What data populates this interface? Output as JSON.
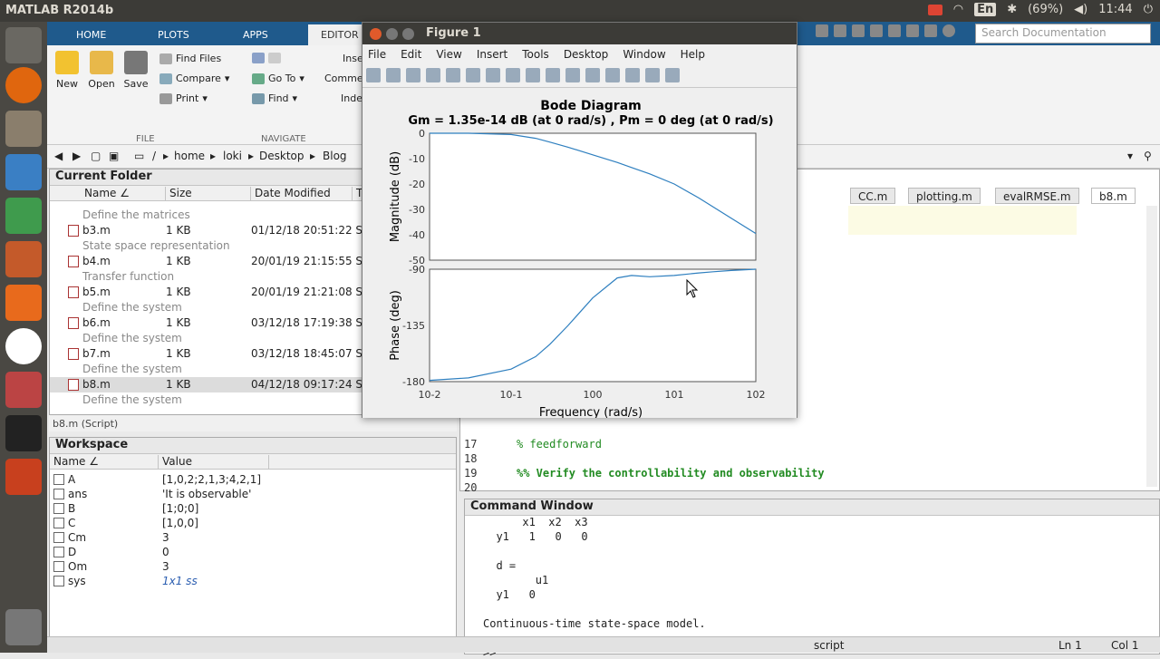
{
  "topbar": {
    "title": "MATLAB R2014b",
    "lang": "En",
    "battery": "(69%)",
    "time": "11:44"
  },
  "ribbon": {
    "tabs": [
      "HOME",
      "PLOTS",
      "APPS",
      "EDITOR"
    ],
    "new": "New",
    "open": "Open",
    "save": "Save",
    "find_files": "Find Files",
    "compare": "Compare",
    "print": "Print",
    "goto": "Go To",
    "comment": "Comme",
    "find": "Find",
    "insert": "Inse",
    "indent": "Inde",
    "file_group": "FILE",
    "navigate_group": "NAVIGATE"
  },
  "search_placeholder": "Search Documentation",
  "address": {
    "root": "/",
    "parts": [
      "home",
      "loki",
      "Desktop",
      "Blog"
    ]
  },
  "folder": {
    "title": "Current Folder",
    "headers": [
      "Name ∠",
      "Size",
      "Date Modified",
      "T"
    ],
    "rows": [
      {
        "desc": "Define the matrices"
      },
      {
        "name": "b3.m",
        "size": "1 KB",
        "date": "01/12/18 20:51:22",
        "t": "S"
      },
      {
        "desc": "State space representation"
      },
      {
        "name": "b4.m",
        "size": "1 KB",
        "date": "20/01/19 21:15:55",
        "t": "S"
      },
      {
        "desc": "Transfer function"
      },
      {
        "name": "b5.m",
        "size": "1 KB",
        "date": "20/01/19 21:21:08",
        "t": "S"
      },
      {
        "desc": "Define the system"
      },
      {
        "name": "b6.m",
        "size": "1 KB",
        "date": "03/12/18 17:19:38",
        "t": "S"
      },
      {
        "desc": "Define the system"
      },
      {
        "name": "b7.m",
        "size": "1 KB",
        "date": "03/12/18 18:45:07",
        "t": "S"
      },
      {
        "desc": "Define the system"
      },
      {
        "name": "b8.m",
        "size": "1 KB",
        "date": "04/12/18 09:17:24",
        "t": "S"
      },
      {
        "desc": "Define the system"
      }
    ],
    "script_label": "b8.m (Script)"
  },
  "workspace": {
    "title": "Workspace",
    "headers": [
      "Name ∠",
      "Value"
    ],
    "rows": [
      {
        "name": "A",
        "value": "[1,0,2;2,1,3;4,2,1]"
      },
      {
        "name": "ans",
        "value": "'It is observable'"
      },
      {
        "name": "B",
        "value": "[1;0;0]"
      },
      {
        "name": "C",
        "value": "[1,0,0]"
      },
      {
        "name": "Cm",
        "value": "3"
      },
      {
        "name": "D",
        "value": "0"
      },
      {
        "name": "Om",
        "value": "3"
      },
      {
        "name": "sys",
        "value": "1x1 ss"
      }
    ]
  },
  "editor": {
    "tabs": [
      "CC.m",
      "plotting.m",
      "evalRMSE.m",
      "b8.m"
    ],
    "lines": [
      {
        "n": "17",
        "code": "% feedforward"
      },
      {
        "n": "19",
        "code": "%% Verify the controllability and observability"
      },
      {
        "n": "18",
        "code": ""
      },
      {
        "n": "20",
        "code": ""
      }
    ]
  },
  "command": {
    "title": "Command Window",
    "lines": [
      "      x1  x2  x3",
      "  y1   1   0   0",
      "",
      "  d =",
      "        u1",
      "  y1   0",
      "",
      "Continuous-time state-space model.",
      "",
      ">>"
    ]
  },
  "status": {
    "mode": "script",
    "ln": "Ln  1",
    "col": "Col  1"
  },
  "figure": {
    "title": "Figure 1",
    "menu": [
      "File",
      "Edit",
      "View",
      "Insert",
      "Tools",
      "Desktop",
      "Window",
      "Help"
    ]
  },
  "chart_data": {
    "type": "line",
    "title": "Bode Diagram",
    "subtitle": "Gm = 1.35e-14 dB (at 0 rad/s) ,  Pm = 0 deg (at 0 rad/s)",
    "xlabel": "Frequency  (rad/s)",
    "x_scale": "log",
    "xlim": [
      0.01,
      100
    ],
    "x_ticks": [
      "10-2",
      "10-1",
      "100",
      "101",
      "102"
    ],
    "magnitude": {
      "ylabel": "Magnitude (dB)",
      "ylim": [
        -50,
        0
      ],
      "y_ticks": [
        "0",
        "-10",
        "-20",
        "-30",
        "-40",
        "-50"
      ],
      "x": [
        0.01,
        0.03,
        0.1,
        0.2,
        0.3,
        0.5,
        1,
        2,
        3,
        5,
        10,
        20,
        30,
        50,
        100
      ],
      "y": [
        0,
        0,
        -0.5,
        -2,
        -3.5,
        -5.5,
        -8.5,
        -11.5,
        -13.5,
        -16,
        -20,
        -25.5,
        -29,
        -33.5,
        -39.5
      ]
    },
    "phase": {
      "ylabel": "Phase (deg)",
      "ylim": [
        -180,
        -90
      ],
      "y_ticks": [
        "-90",
        "-135",
        "-180"
      ],
      "x": [
        0.01,
        0.03,
        0.1,
        0.2,
        0.3,
        0.5,
        1,
        2,
        3,
        5,
        10,
        20,
        30,
        50,
        100
      ],
      "y": [
        -179,
        -177,
        -170,
        -160,
        -150,
        -135,
        -113,
        -97,
        -95,
        -96,
        -95,
        -93,
        -92,
        -91,
        -90
      ]
    },
    "color": "#2e7fbf"
  }
}
